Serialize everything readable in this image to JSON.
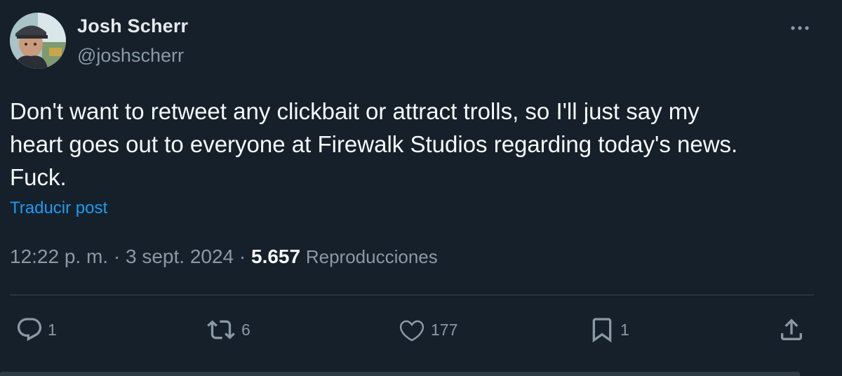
{
  "author": {
    "name": "Josh Scherr",
    "handle": "@joshscherr"
  },
  "post": {
    "lines": [
      "Don't want to retweet any clickbait or attract trolls, so I'll just say my",
      "heart goes out to everyone at Firewalk Studios regarding today's news.",
      "Fuck."
    ],
    "translate_label": "Traducir post"
  },
  "meta": {
    "time": "12:22 p. m.",
    "separator": "·",
    "date": "3 sept. 2024",
    "views_count": "5.657",
    "views_label": "Reproducciones"
  },
  "actions": {
    "reply": {
      "icon": "reply-icon",
      "count": "1"
    },
    "retweet": {
      "icon": "retweet-icon",
      "count": "6"
    },
    "like": {
      "icon": "heart-icon",
      "count": "177"
    },
    "bookmark": {
      "icon": "bookmark-icon",
      "count": "1"
    },
    "share": {
      "icon": "share-icon"
    }
  },
  "colors": {
    "background": "#15202b",
    "text": "#f7f9f9",
    "secondary": "#8b98a5",
    "link": "#1d9bf0",
    "divider": "#38444d"
  }
}
